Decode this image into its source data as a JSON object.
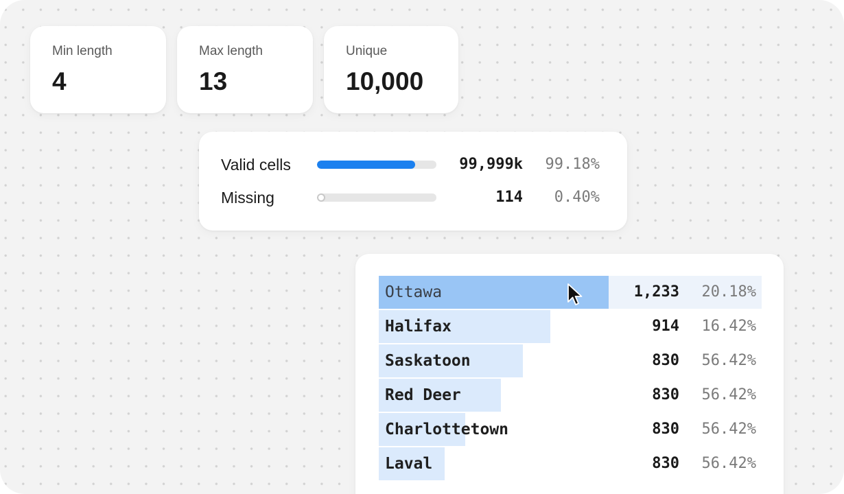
{
  "stats": [
    {
      "label": "Min length",
      "value": "4"
    },
    {
      "label": "Max length",
      "value": "13"
    },
    {
      "label": "Unique",
      "value": "10,000"
    }
  ],
  "quality": [
    {
      "label": "Valid cells",
      "count": "99,999k",
      "percent": "99.18%",
      "fill_fraction": 0.82,
      "color": "#1b80ef"
    },
    {
      "label": "Missing",
      "count": "114",
      "percent": "0.40%",
      "fill_fraction": 0.004,
      "color": "#ffffff"
    }
  ],
  "top_values": [
    {
      "name": "Ottawa",
      "count": "1,233",
      "percent": "20.18%",
      "bar_fraction": 0.6
    },
    {
      "name": "Halifax",
      "count": "914",
      "percent": "16.42%",
      "bar_fraction": 0.448
    },
    {
      "name": "Saskatoon",
      "count": "830",
      "percent": "56.42%",
      "bar_fraction": 0.376
    },
    {
      "name": "Red Deer",
      "count": "830",
      "percent": "56.42%",
      "bar_fraction": 0.319
    },
    {
      "name": "Charlottetown",
      "count": "830",
      "percent": "56.42%",
      "bar_fraction": 0.226
    },
    {
      "name": "Laval",
      "count": "830",
      "percent": "56.42%",
      "bar_fraction": 0.172
    }
  ],
  "colors": {
    "accent": "#1b80ef",
    "bar_light": "#dbeafc",
    "bar_active": "#99c5f5",
    "row_active_bg": "#edf3fb"
  },
  "icons": {
    "cursor": "mouse-pointer-icon"
  }
}
